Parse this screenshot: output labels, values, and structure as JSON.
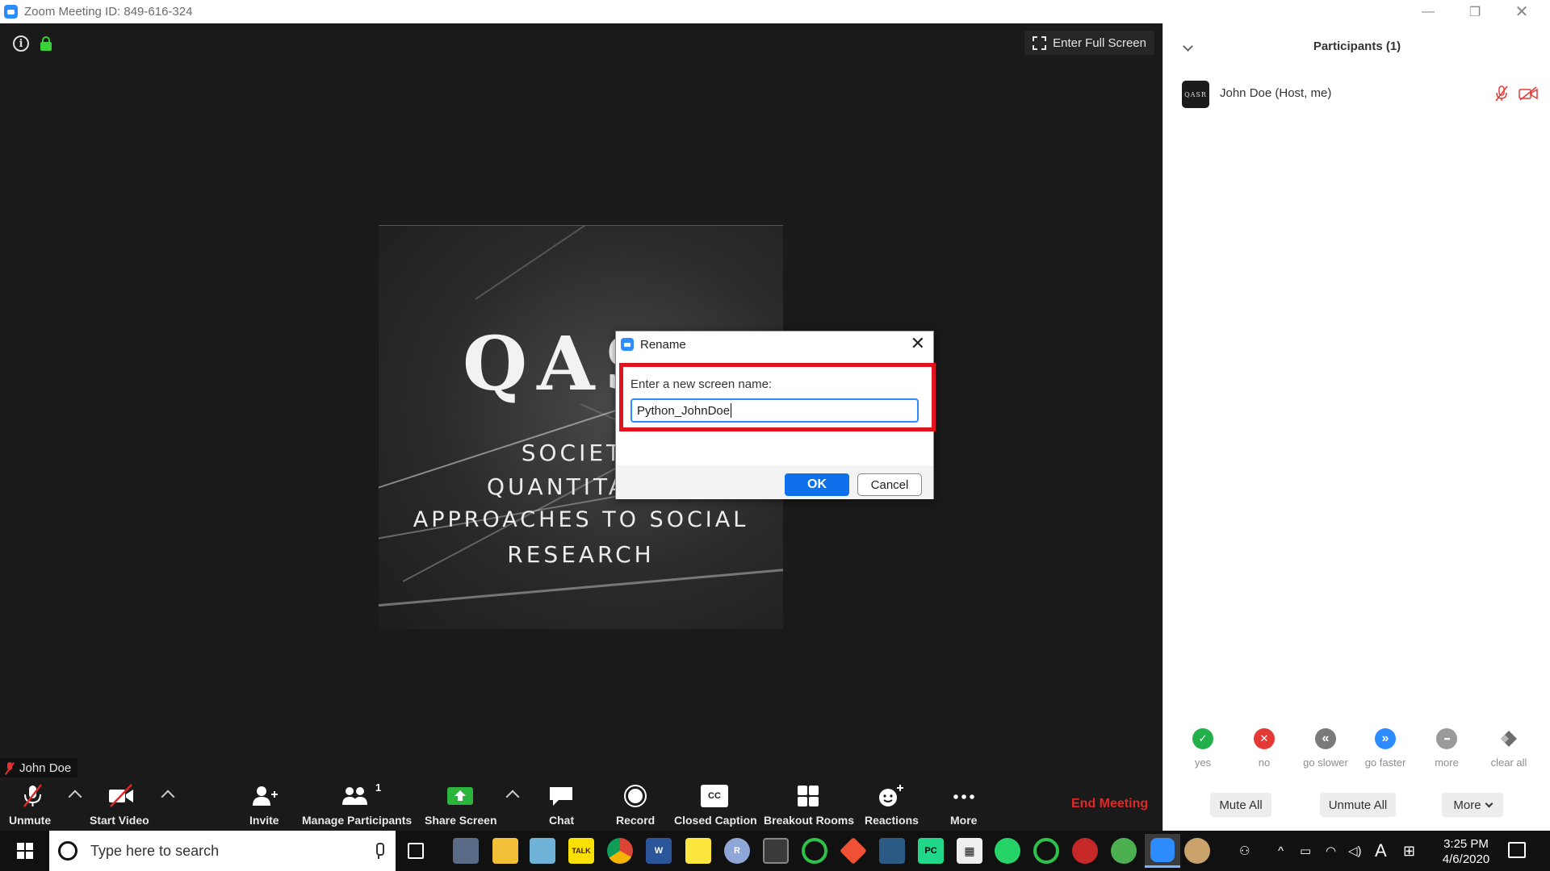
{
  "window": {
    "title": "Zoom Meeting ID: 849-616-324",
    "min_icon": "minimize-icon",
    "restore_icon": "restore-icon",
    "close_icon": "close-icon"
  },
  "video": {
    "fullscreen_label": "Enter Full Screen",
    "profile_logo_text": "QAS",
    "profile_lines": [
      "SOCIETY",
      "QUANTITA",
      "APPROACHES TO SOCIAL",
      "RESEARCH"
    ],
    "name_tag": "John Doe"
  },
  "rename_dialog": {
    "title": "Rename",
    "prompt": "Enter a new screen name:",
    "value": "Python_JohnDoe",
    "ok_label": "OK",
    "cancel_label": "Cancel",
    "highlight_color": "#e0141e"
  },
  "toolbar": {
    "unmute": "Unmute",
    "start_video": "Start Video",
    "invite": "Invite",
    "manage_participants": "Manage Participants",
    "participant_count": "1",
    "share_screen": "Share Screen",
    "chat": "Chat",
    "record": "Record",
    "closed_caption": "Closed Caption",
    "cc_glyph": "CC",
    "breakout_rooms": "Breakout Rooms",
    "reactions": "Reactions",
    "more": "More",
    "end_meeting": "End Meeting"
  },
  "participants_panel": {
    "title": "Participants (1)",
    "participants": [
      {
        "name": "John Doe (Host, me)",
        "avatar_text": "QASR",
        "audio": "muted",
        "video": "off"
      }
    ],
    "feedback": [
      {
        "label": "yes",
        "color": "#22b04a",
        "glyph": "✓"
      },
      {
        "label": "no",
        "color": "#e53935",
        "glyph": "✕"
      },
      {
        "label": "go slower",
        "color": "#7a7a7a",
        "glyph": "«"
      },
      {
        "label": "go faster",
        "color": "#2d8cff",
        "glyph": "»"
      },
      {
        "label": "more",
        "color": "#9a9a9a",
        "glyph": "•••"
      },
      {
        "label": "clear all",
        "color": "#8d8d8d",
        "glyph": ""
      }
    ],
    "mute_all": "Mute All",
    "unmute_all": "Unmute All",
    "more": "More"
  },
  "taskbar": {
    "search_placeholder": "Type here to search",
    "time": "3:25 PM",
    "date": "4/6/2020"
  }
}
